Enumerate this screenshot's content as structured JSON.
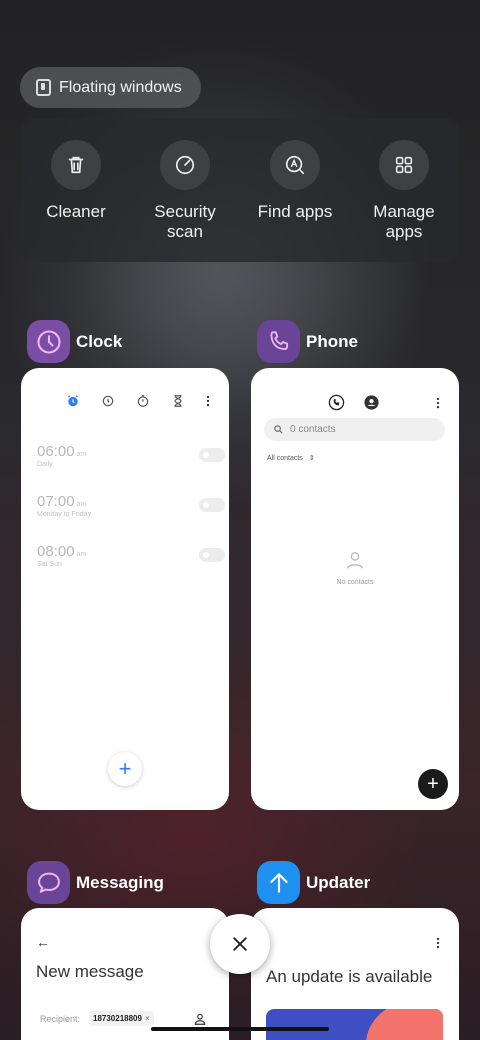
{
  "floating_windows": {
    "label": "Floating windows",
    "icon": "floating-window-icon"
  },
  "quick_actions": [
    {
      "label": "Cleaner",
      "icon": "trash-icon"
    },
    {
      "label": "Security\nscan",
      "line1": "Security",
      "line2": "scan",
      "icon": "security-scan-icon"
    },
    {
      "label": "Find apps",
      "icon": "find-apps-icon"
    },
    {
      "label": "Manage\napps",
      "line1": "Manage",
      "line2": "apps",
      "icon": "grid-icon"
    }
  ],
  "apps": {
    "clock": {
      "name": "Clock",
      "icon": "clock-icon",
      "icon_bg": "#7b4ea6",
      "alarms": [
        {
          "time": "06:00",
          "ampm": "am",
          "repeat": "Daily"
        },
        {
          "time": "07:00",
          "ampm": "am",
          "repeat": "Monday to Friday"
        },
        {
          "time": "08:00",
          "ampm": "am",
          "repeat": "Sat Sun"
        }
      ]
    },
    "phone": {
      "name": "Phone",
      "icon": "phone-icon",
      "icon_bg": "#6a4496",
      "search_placeholder": "0 contacts",
      "filter": "All contacts",
      "empty_text": "No contacts"
    },
    "messaging": {
      "name": "Messaging",
      "icon": "message-icon",
      "icon_bg": "#6a4496",
      "title": "New message",
      "recipient_label": "Recipient:",
      "recipient_chip": "18730218809"
    },
    "updater": {
      "name": "Updater",
      "icon": "arrow-up-icon",
      "icon_bg": "#1e90f0",
      "title": "An update is available"
    }
  },
  "colors": {
    "accent_blue": "#2e7cf6",
    "purple_icon": "#c07ad8"
  }
}
